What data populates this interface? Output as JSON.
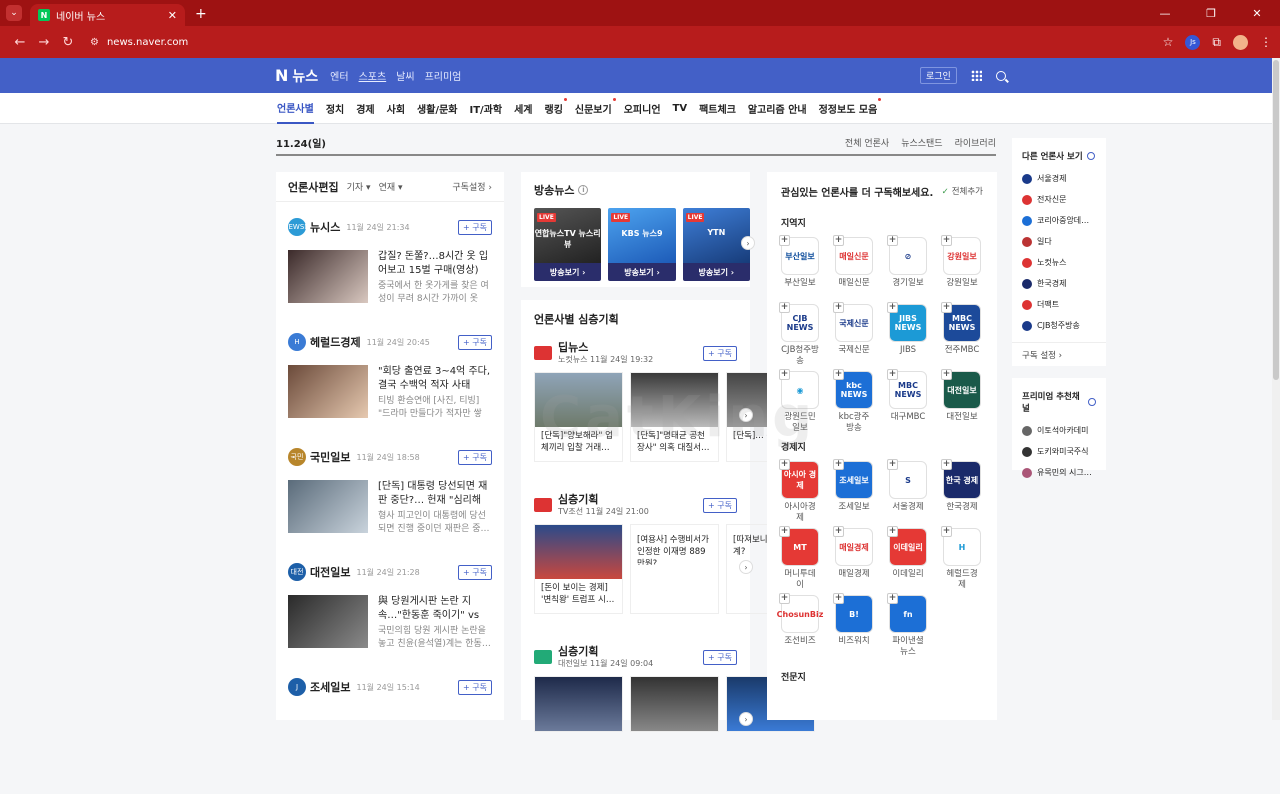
{
  "browser": {
    "tab_title": "네이버 뉴스",
    "tab_close": "✕",
    "new_tab": "+",
    "url": "news.naver.com",
    "win_controls": [
      "—",
      "❐",
      "✕"
    ],
    "ext_label": "Js"
  },
  "header": {
    "logo": "뉴스",
    "logo_n": "N",
    "menu": [
      "엔터",
      "스포츠",
      "날씨",
      "프리미엄"
    ],
    "login": "로그인"
  },
  "categories": [
    {
      "label": "언론사별",
      "active": true,
      "dot": false
    },
    {
      "label": "정치",
      "dot": false
    },
    {
      "label": "경제",
      "dot": false
    },
    {
      "label": "사회",
      "dot": false
    },
    {
      "label": "생활/문화",
      "dot": false
    },
    {
      "label": "IT/과학",
      "dot": false
    },
    {
      "label": "세계",
      "dot": false
    },
    {
      "label": "랭킹",
      "dot": true
    },
    {
      "label": "신문보기",
      "dot": true
    },
    {
      "label": "오피니언",
      "dot": false
    },
    {
      "label": "TV",
      "dot": false
    },
    {
      "label": "팩트체크",
      "dot": false
    },
    {
      "label": "알고리즘 안내",
      "dot": false
    },
    {
      "label": "정정보도 모음",
      "dot": true
    }
  ],
  "datebar": {
    "date": "11.24(일)",
    "links": [
      "전체 언론사",
      "뉴스스탠드",
      "라이브러리"
    ]
  },
  "editor": {
    "title": "언론사편집",
    "filters": [
      "기자 ▾",
      "연재 ▾"
    ],
    "settings": "구독설정 ›",
    "subscribe": "+ 구독",
    "publishers": [
      {
        "name": "뉴시스",
        "time": "11월 24일 21:34",
        "icon_color": "#2c9bd6",
        "icon_text": "NEWSIS",
        "img": "linear-gradient(135deg,#3b2a2a,#d9c8c0)",
        "headline": "갑질? 돈쭐?…8시간 옷 입어보고 15벌 구매(영상)",
        "desc": "중국에서 한 옷가게를 찾은 여성이 무려 8시간 가까이 옷을…"
      },
      {
        "name": "헤럴드경제",
        "time": "11월 24일 20:45",
        "icon_color": "#3a7bd5",
        "icon_text": "H",
        "img": "linear-gradient(135deg,#6b4a3a,#e6c9b0)",
        "headline": "\"회당 출연료 3~4억 주다, 결국 수백억 적자 사태 터…",
        "desc": "티빙 환승연애 [사진, 티빙] \"드라마 만들다가 적자만 쌓였…"
      },
      {
        "name": "국민일보",
        "time": "11월 24일 18:58",
        "icon_color": "#b8862b",
        "icon_text": "국민",
        "img": "linear-gradient(135deg,#5a6b7a,#c9d3dc)",
        "headline": "[단독] 대통령 당선되면 재판 중단?… 헌재 \"심리해 봐야…",
        "desc": "형사 피고인이 대통령에 당선되면 진행 중이던 재판은 중…"
      },
      {
        "name": "대전일보",
        "time": "11월 24일 21:28",
        "icon_color": "#1d5fa8",
        "icon_text": "대전",
        "img": "linear-gradient(135deg,#2a2a2a,#8a8a8a)",
        "headline": "與 당원게시판 논란 지속…\"한동훈 죽이기\" vs \"해명 …",
        "desc": "국민의힘 당원 게시판 논란을 놓고 친윤(윤석열)계는 한동…"
      },
      {
        "name": "조세일보",
        "time": "11월 24일 15:14",
        "icon_color": "#1d5fa8",
        "icon_text": "J",
        "img": "",
        "headline": "",
        "desc": ""
      }
    ]
  },
  "broadcast": {
    "title": "방송뉴스",
    "info": "i",
    "items": [
      {
        "brand": "연합뉴스TV 뉴스리뷰",
        "live": "LIVE",
        "btn": "방송보기 ›",
        "img": "linear-gradient(160deg,#555,#222)"
      },
      {
        "brand": "KBS 뉴스9",
        "live": "LIVE",
        "btn": "방송보기 ›",
        "img": "linear-gradient(160deg,#4da3ef,#1d5bb8)"
      },
      {
        "brand": "YTN",
        "live": "LIVE",
        "btn": "방송보기 ›",
        "img": "linear-gradient(160deg,#3f7fd8,#173c7a)"
      }
    ]
  },
  "deep": {
    "title": "언론사별 심층기획",
    "subscribe": "+ 구독",
    "groups": [
      {
        "name": "딥뉴스",
        "sub": "노컷뉴스",
        "time": "11월 24일 19:32",
        "logo_color": "#d33",
        "cards": [
          {
            "img": "linear-gradient(180deg,#8fa4b8,#6e7a6a)",
            "text": "[단독]\"양보해라\" 업체끼리 입찰 거래…"
          },
          {
            "img": "linear-gradient(180deg,#3a3a3a,#bbb)",
            "text": "[단독]\"명태균 공천 장사\" 의혹 대질서…"
          },
          {
            "img": "linear-gradient(180deg,#444,#999)",
            "text": "[단독]… 윤핵…"
          }
        ]
      },
      {
        "name": "심층기획",
        "sub": "TV조선",
        "time": "11월 24일 21:00",
        "logo_color": "#d33",
        "cards": [
          {
            "img": "linear-gradient(180deg,#2b4a8a,#c9483e)",
            "text": "[돈이 보이는 경제] '변칙왕' 트럼프 시…"
          },
          {
            "img": "",
            "text": "[여용사] 수행비서가 인정한 이재명 889만원?"
          },
          {
            "img": "",
            "text": "[따져보니] 사' 정… 계?"
          }
        ]
      },
      {
        "name": "심층기획",
        "sub": "대전일보",
        "time": "11월 24일 09:04",
        "logo_color": "#2a7",
        "cards": [
          {
            "img": "linear-gradient(180deg,#1e2a4a,#6b7a9a)",
            "text": ""
          },
          {
            "img": "linear-gradient(180deg,#333,#888)",
            "text": ""
          },
          {
            "img": "linear-gradient(180deg,#1a3a6a,#3a7ad5)",
            "text": ""
          }
        ]
      }
    ]
  },
  "recommend": {
    "title": "관심있는 언론사를 더 구독해보세요.",
    "add_all": "전체추가",
    "sections": [
      {
        "title": "지역지",
        "items": [
          {
            "label": "부산일보",
            "bg": "#fff",
            "fg": "#0a4a9a",
            "mark": "부산일보"
          },
          {
            "label": "매일신문",
            "bg": "#fff",
            "fg": "#d33",
            "mark": "매일신문"
          },
          {
            "label": "경기일보",
            "bg": "#fff",
            "fg": "#1a3a8a",
            "mark": "⊘"
          },
          {
            "label": "강원일보",
            "bg": "#fff",
            "fg": "#d33",
            "mark": "강원일보"
          },
          {
            "label": "CJB청주방송",
            "bg": "#fff",
            "fg": "#1a3a8a",
            "mark": "CJB NEWS"
          },
          {
            "label": "국제신문",
            "bg": "#fff",
            "fg": "#1a3a8a",
            "mark": "국제신문"
          },
          {
            "label": "JIBS",
            "bg": "#1c9ad6",
            "fg": "#fff",
            "mark": "JIBS NEWS"
          },
          {
            "label": "전주MBC",
            "bg": "#1c4a9a",
            "fg": "#fff",
            "mark": "MBC NEWS"
          },
          {
            "label": "광원드민일보",
            "bg": "#fff",
            "fg": "#1c9ad6",
            "mark": "◉"
          },
          {
            "label": "kbc광주방송",
            "bg": "#1c6fd6",
            "fg": "#fff",
            "mark": "kbc NEWS"
          },
          {
            "label": "대구MBC",
            "bg": "#fff",
            "fg": "#1a3a8a",
            "mark": "MBC NEWS"
          },
          {
            "label": "대전일보",
            "bg": "#1a5a4a",
            "fg": "#fff",
            "mark": "대전일보"
          }
        ]
      },
      {
        "title": "경제지",
        "items": [
          {
            "label": "아시아경제",
            "bg": "#e53935",
            "fg": "#fff",
            "mark": "아시아 경제"
          },
          {
            "label": "조세일보",
            "bg": "#1c6fd6",
            "fg": "#fff",
            "mark": "조세일보"
          },
          {
            "label": "서울경제",
            "bg": "#fff",
            "fg": "#1a3a8a",
            "mark": "S"
          },
          {
            "label": "한국경제",
            "bg": "#1a2a6a",
            "fg": "#fff",
            "mark": "한국 경제"
          },
          {
            "label": "머니투데이",
            "bg": "#e53935",
            "fg": "#fff",
            "mark": "MT"
          },
          {
            "label": "매일경제",
            "bg": "#fff",
            "fg": "#d33",
            "mark": "매일경제"
          },
          {
            "label": "이데일리",
            "bg": "#e53935",
            "fg": "#fff",
            "mark": "이데일리"
          },
          {
            "label": "헤럴드경제",
            "bg": "#fff",
            "fg": "#1c9ad6",
            "mark": "H"
          },
          {
            "label": "조선비즈",
            "bg": "#fff",
            "fg": "#d33",
            "mark": "ChosunBiz"
          },
          {
            "label": "비즈워치",
            "bg": "#1c6fd6",
            "fg": "#fff",
            "mark": "B!"
          },
          {
            "label": "파이낸셜뉴스",
            "bg": "#1c6fd6",
            "fg": "#fff",
            "mark": "fn"
          }
        ]
      }
    ],
    "more_section": "전문지"
  },
  "side": {
    "title": "다른 언론사 보기",
    "items": [
      {
        "label": "서울경제",
        "color": "#1a3a8a"
      },
      {
        "label": "전자신문",
        "color": "#d33"
      },
      {
        "label": "코리아중앙데…",
        "color": "#1c6fd6"
      },
      {
        "label": "일다",
        "color": "#b33"
      },
      {
        "label": "노컷뉴스",
        "color": "#d33"
      },
      {
        "label": "한국경제",
        "color": "#1a2a6a"
      },
      {
        "label": "더팩트",
        "color": "#d33"
      },
      {
        "label": "CJB청주방송",
        "color": "#1a3a8a"
      }
    ],
    "settings": "구독 설정 ›",
    "premium_title": "프리미엄 추천채널",
    "premium": [
      {
        "label": "이토석아카데미",
        "color": "#666"
      },
      {
        "label": "도키와미국주식",
        "color": "#333"
      },
      {
        "label": "유목민의 시그…",
        "color": "#a57"
      }
    ]
  },
  "watermark": "CatKing"
}
